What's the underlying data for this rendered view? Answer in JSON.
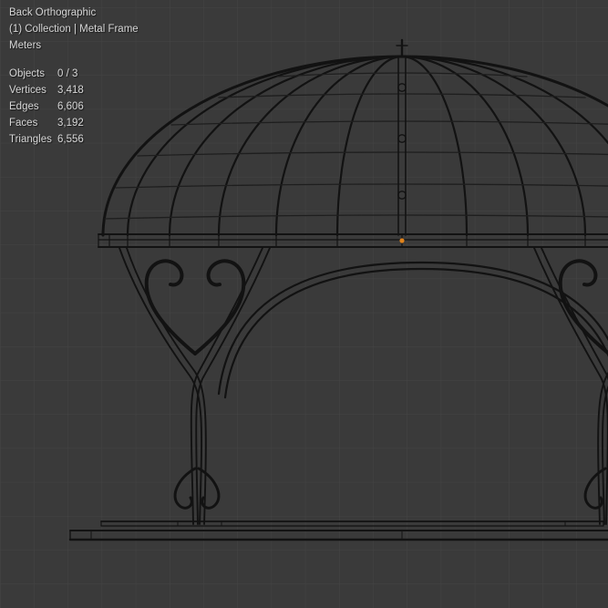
{
  "viewport": {
    "view_label": "Back Orthographic",
    "context_label": "(1) Collection | Metal Frame",
    "unit_label": "Meters",
    "stats": [
      {
        "label": "Objects",
        "value": "0 / 3"
      },
      {
        "label": "Vertices",
        "value": "3,418"
      },
      {
        "label": "Edges",
        "value": "6,606"
      },
      {
        "label": "Faces",
        "value": "3,192"
      },
      {
        "label": "Triangles",
        "value": "6,556"
      }
    ],
    "model_name": "Metal Frame",
    "colors": {
      "background": "#3a3a3a",
      "grid_line": "#444444",
      "wireframe": "#121212",
      "overlay_text": "#d6d6d6",
      "origin_point": "#e0831c"
    }
  }
}
